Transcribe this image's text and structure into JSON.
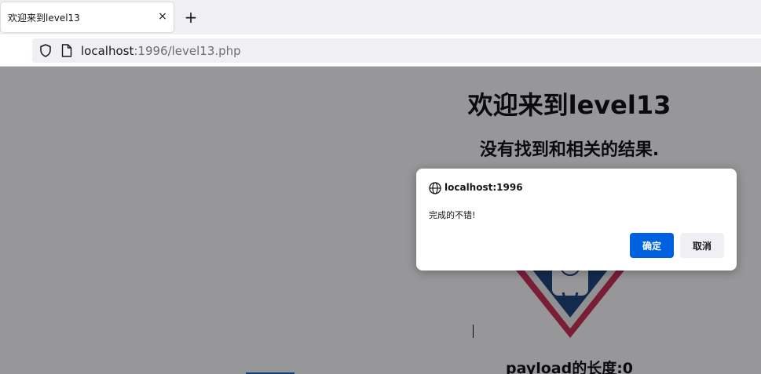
{
  "browser": {
    "tab_title": "欢迎来到level13",
    "tab_close": "×",
    "new_tab": "+",
    "url_host": "localhost",
    "url_rest": ":1996/level13.php"
  },
  "page": {
    "title": "欢迎来到level13",
    "subtitle": "没有找到和相关的结果.",
    "payload_length": "payload的长度:0"
  },
  "dialog": {
    "origin": "localhost:1996",
    "message": "完成的不错!",
    "ok_label": "确定",
    "cancel_label": "取消"
  },
  "colors": {
    "accent": "#0061e0",
    "logo_red": "#c8234a",
    "logo_blue": "#0d3a72"
  }
}
